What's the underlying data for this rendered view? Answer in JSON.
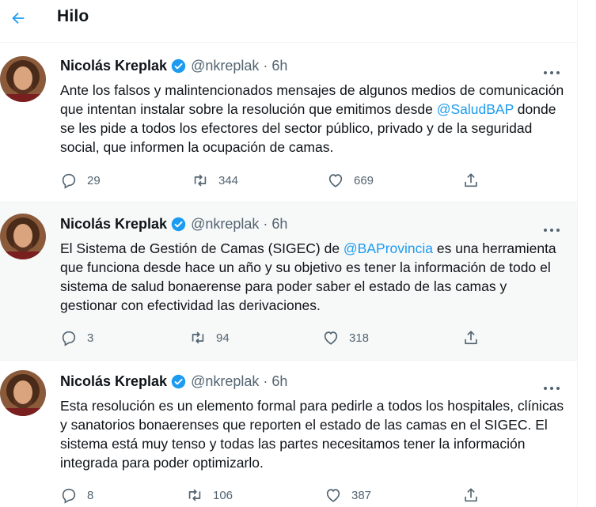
{
  "header": {
    "title": "Hilo"
  },
  "tweets": [
    {
      "author": "Nicolás Kreplak",
      "handle": "@nkreplak",
      "separator": "·",
      "time": "6h",
      "text_parts": [
        "Ante los falsos y malintencionados mensajes de algunos medios de comunicación que intentan instalar sobre la resolución que emitimos desde ",
        "@SaludBAP",
        " donde se les pide a todos los efectores del sector público, privado y de la seguridad social, que informen la ocupación de camas."
      ],
      "replies": "29",
      "retweets": "344",
      "likes": "669"
    },
    {
      "author": "Nicolás Kreplak",
      "handle": "@nkreplak",
      "separator": "·",
      "time": "6h",
      "text_parts": [
        "El Sistema de Gestión de Camas (SIGEC) de ",
        "@BAProvincia",
        " es una herramienta que funciona desde hace un año y su objetivo es tener la información de todo el sistema de salud bonaerense para poder saber el estado de las camas y gestionar con efectividad las derivaciones."
      ],
      "replies": "3",
      "retweets": "94",
      "likes": "318"
    },
    {
      "author": "Nicolás Kreplak",
      "handle": "@nkreplak",
      "separator": "·",
      "time": "6h",
      "text_parts": [
        "Esta resolución es un elemento formal para pedirle a todos los hospitales, clínicas y sanatorios bonaerenses que reporten el estado de las camas en el SIGEC. El sistema está muy tenso y todas las partes necesitamos tener la información integrada para poder optimizarlo.",
        "",
        ""
      ],
      "replies": "8",
      "retweets": "106",
      "likes": "387"
    }
  ],
  "colors": {
    "accent": "#1d9bf0",
    "muted": "#536471",
    "text": "#0f1419",
    "highlight_bg": "#f7f9f9"
  }
}
